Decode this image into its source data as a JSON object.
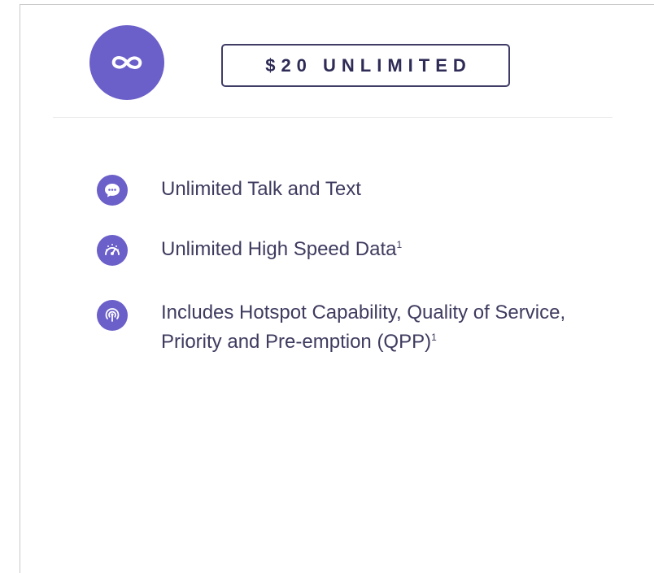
{
  "colors": {
    "accent": "#6b5fc9",
    "badge_border": "#3f3c66",
    "text": "#3e3b5f"
  },
  "plan": {
    "logo_icon": "infinity-icon",
    "name": "$20 UNLIMITED"
  },
  "features": [
    {
      "icon": "chat-bubble-icon",
      "line1": "Unlimited Talk and Text",
      "line2": "",
      "footnote": ""
    },
    {
      "icon": "speedometer-icon",
      "line1": "Unlimited High Speed Data",
      "line2": "",
      "footnote": "1"
    },
    {
      "icon": "hotspot-icon",
      "line1": "Includes Hotspot Capability, Quality of Service,",
      "line2": "Priority and Pre-emption (QPP)",
      "footnote": "1"
    }
  ]
}
